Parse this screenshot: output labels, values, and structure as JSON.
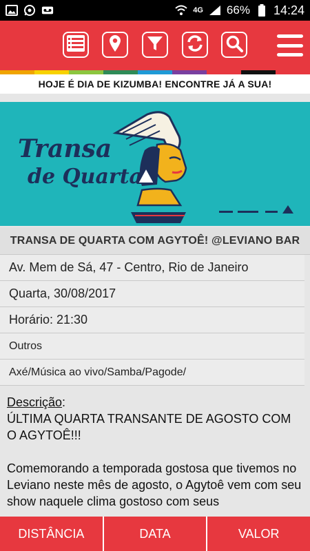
{
  "status_bar": {
    "network": "4G",
    "battery": "66%",
    "time": "14:24"
  },
  "toolbar": {
    "icons": [
      "list-icon",
      "location-pin-icon",
      "filter-icon",
      "refresh-icon",
      "search-icon",
      "menu-icon"
    ]
  },
  "banner": {
    "text": "HOJE É DIA DE KIZUMBA! ENCONTRE JÁ A SUA!"
  },
  "hero": {
    "logo_line1": "Transa",
    "logo_line2": "de Quarta"
  },
  "event": {
    "title": "TRANSA DE QUARTA COM AGYTOÊ! @LEVIANO BAR",
    "address": "Av. Mem de Sá, 47 - Centro, Rio de Janeiro",
    "date": "Quarta, 30/08/2017",
    "time": "Horário: 21:30",
    "category": "Outros",
    "genres": "Axé/Música ao vivo/Samba/Pagode/"
  },
  "description": {
    "label": "Descrição",
    "colon": ":",
    "paragraph1": "ÚLTIMA QUARTA TRANSANTE DE AGOSTO COM O AGYTOÊ!!!",
    "paragraph2": "Comemorando a temporada gostosa que tivemos no Leviano neste mês de agosto, o Agytoê vem com seu show naquele clima gostoso com seus"
  },
  "bottom_tabs": {
    "distance": "DISTÂNCIA",
    "date": "DATA",
    "value": "VALOR"
  },
  "colors": {
    "accent": "#e7383f",
    "hero_bg": "#1fb5ba",
    "stripe": [
      "#f0a400",
      "#f7d200",
      "#8cc63f",
      "#2e8b57",
      "#1f9ad6",
      "#7a3fa0",
      "#e7383f",
      "#111111",
      "#e7383f"
    ]
  }
}
